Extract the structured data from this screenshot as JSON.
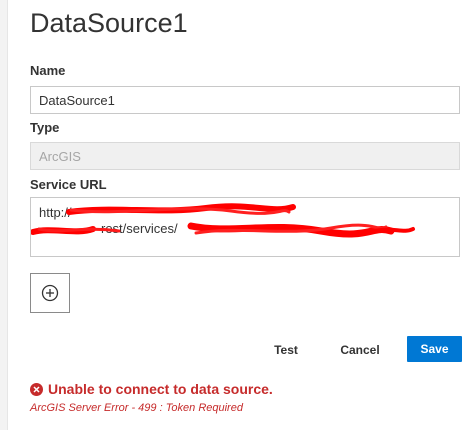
{
  "title": "DataSource1",
  "name": {
    "label": "Name",
    "value": "DataSource1"
  },
  "type": {
    "label": "Type",
    "value": "ArcGIS"
  },
  "service_url": {
    "label": "Service URL",
    "line1": "http://",
    "line2": "rest/services/"
  },
  "buttons": {
    "test": "Test",
    "cancel": "Cancel",
    "save": "Save"
  },
  "error": {
    "title": "Unable to connect to data source.",
    "detail": "ArcGIS Server Error - 499 : Token Required"
  },
  "colors": {
    "accent": "#0078d4",
    "error": "#c62b2b",
    "redaction": "#ff0000"
  }
}
